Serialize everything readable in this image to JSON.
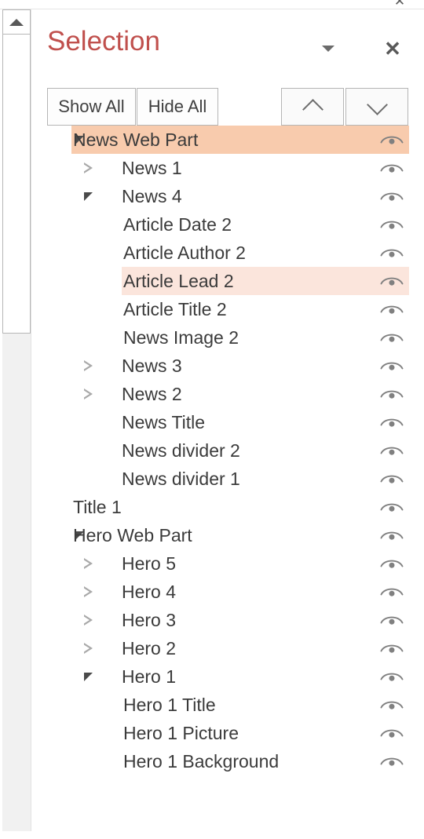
{
  "window": {
    "chrome_close_label": "✕"
  },
  "pane": {
    "title": "Selection",
    "menu_icon": "chevron-down-icon",
    "menu_label": "▼",
    "close_icon": "close-icon",
    "close_label": "✕",
    "accent_color": "#C0504D"
  },
  "toolbar": {
    "show_all_label": "Show All",
    "hide_all_label": "Hide All",
    "move_up_label": "",
    "move_down_label": "",
    "move_up_icon": "chevron-up-icon",
    "move_down_icon": "chevron-down-icon"
  },
  "colors": {
    "selected_row": "#F8CBAD",
    "hover_row": "#FBE5DC",
    "text": "#3B3B3B",
    "icon": "#808080"
  },
  "scrollbar": {
    "up_arrow_icon": "triangle-up-icon",
    "orientation": "vertical",
    "position": "left"
  },
  "tree": {
    "visibility_icon": "eye-icon",
    "rows": [
      {
        "label": "News Web Part",
        "indent": 0,
        "twisty": "expanded",
        "state": "selected",
        "visible": true
      },
      {
        "label": "News 1",
        "indent": 1,
        "twisty": "collapsed",
        "state": "normal",
        "visible": true
      },
      {
        "label": "News 4",
        "indent": 1,
        "twisty": "expanded",
        "state": "normal",
        "visible": true
      },
      {
        "label": "Article Date 2",
        "indent": 2,
        "twisty": "none",
        "state": "normal",
        "visible": true
      },
      {
        "label": "Article Author 2",
        "indent": 2,
        "twisty": "none",
        "state": "normal",
        "visible": true
      },
      {
        "label": "Article Lead 2",
        "indent": 2,
        "twisty": "none",
        "state": "hovered",
        "visible": true
      },
      {
        "label": "Article Title 2",
        "indent": 2,
        "twisty": "none",
        "state": "normal",
        "visible": true
      },
      {
        "label": "News Image 2",
        "indent": 2,
        "twisty": "none",
        "state": "normal",
        "visible": true
      },
      {
        "label": "News 3",
        "indent": 1,
        "twisty": "collapsed",
        "state": "normal",
        "visible": true
      },
      {
        "label": "News 2",
        "indent": 1,
        "twisty": "collapsed",
        "state": "normal",
        "visible": true
      },
      {
        "label": "News Title",
        "indent": 1,
        "twisty": "none",
        "state": "normal",
        "visible": true
      },
      {
        "label": "News divider 2",
        "indent": 1,
        "twisty": "none",
        "state": "normal",
        "visible": true
      },
      {
        "label": "News divider 1",
        "indent": 1,
        "twisty": "none",
        "state": "normal",
        "visible": true
      },
      {
        "label": "Title 1",
        "indent": 0,
        "twisty": "none",
        "state": "normal",
        "visible": true
      },
      {
        "label": "Hero Web Part",
        "indent": 0,
        "twisty": "expanded",
        "state": "normal",
        "visible": true
      },
      {
        "label": "Hero 5",
        "indent": 1,
        "twisty": "collapsed",
        "state": "normal",
        "visible": true
      },
      {
        "label": "Hero 4",
        "indent": 1,
        "twisty": "collapsed",
        "state": "normal",
        "visible": true
      },
      {
        "label": "Hero 3",
        "indent": 1,
        "twisty": "collapsed",
        "state": "normal",
        "visible": true
      },
      {
        "label": "Hero 2",
        "indent": 1,
        "twisty": "collapsed",
        "state": "normal",
        "visible": true
      },
      {
        "label": "Hero 1",
        "indent": 1,
        "twisty": "expanded",
        "state": "normal",
        "visible": true
      },
      {
        "label": "Hero 1 Title",
        "indent": 2,
        "twisty": "none",
        "state": "normal",
        "visible": true
      },
      {
        "label": "Hero 1 Picture",
        "indent": 2,
        "twisty": "none",
        "state": "normal",
        "visible": true
      },
      {
        "label": "Hero 1 Background",
        "indent": 2,
        "twisty": "none",
        "state": "normal",
        "visible": true
      }
    ]
  }
}
